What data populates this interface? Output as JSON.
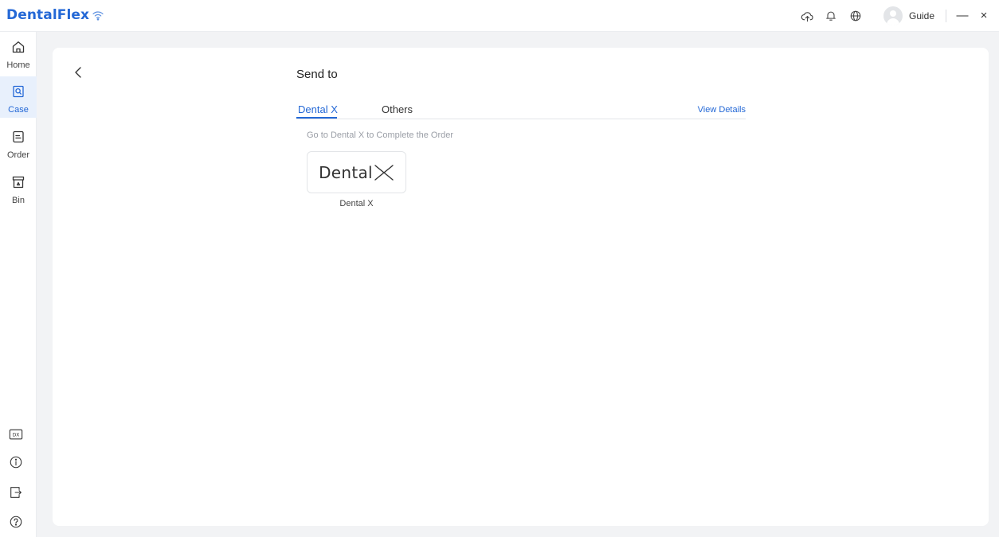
{
  "app": {
    "brand": "DentalFlex",
    "user_name": "Guide",
    "minimize_symbol": "—",
    "close_symbol": "×",
    "accent_color": "#2468d6"
  },
  "topbar_icons": [
    "cloud-upload-icon",
    "bell-icon",
    "globe-icon",
    "avatar"
  ],
  "sidebar": {
    "items": [
      {
        "label": "Home",
        "icon": "home-icon",
        "active": false
      },
      {
        "label": "Case",
        "icon": "case-icon",
        "active": true
      },
      {
        "label": "Order",
        "icon": "order-icon",
        "active": false
      },
      {
        "label": "Bin",
        "icon": "bin-icon",
        "active": false
      }
    ],
    "bottom_icons": [
      "dx-icon",
      "info-icon",
      "logout-icon",
      "help-icon"
    ],
    "dx_badge": "DX"
  },
  "main": {
    "title": "Send to",
    "tabs": [
      {
        "label": "Dental X",
        "active": true
      },
      {
        "label": "Others",
        "active": false
      }
    ],
    "view_details": "View Details",
    "hint": "Go to Dental X to Complete the Order",
    "platform": {
      "logo_text": "Dental",
      "name": "Dental X"
    }
  }
}
